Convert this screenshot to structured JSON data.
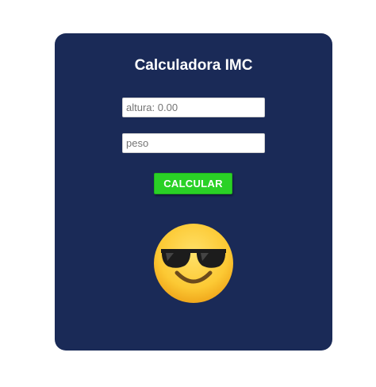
{
  "app": {
    "title": "Calculadora IMC"
  },
  "form": {
    "altura": {
      "placeholder": "altura: 0.00",
      "value": ""
    },
    "peso": {
      "placeholder": "peso",
      "value": ""
    },
    "submit_label": "CALCULAR"
  },
  "result": {
    "icon": "sunglasses-emoji-icon"
  },
  "colors": {
    "card_bg": "#1a2a57",
    "button_bg": "#2ad126",
    "emoji_face": "#fbc02d"
  }
}
